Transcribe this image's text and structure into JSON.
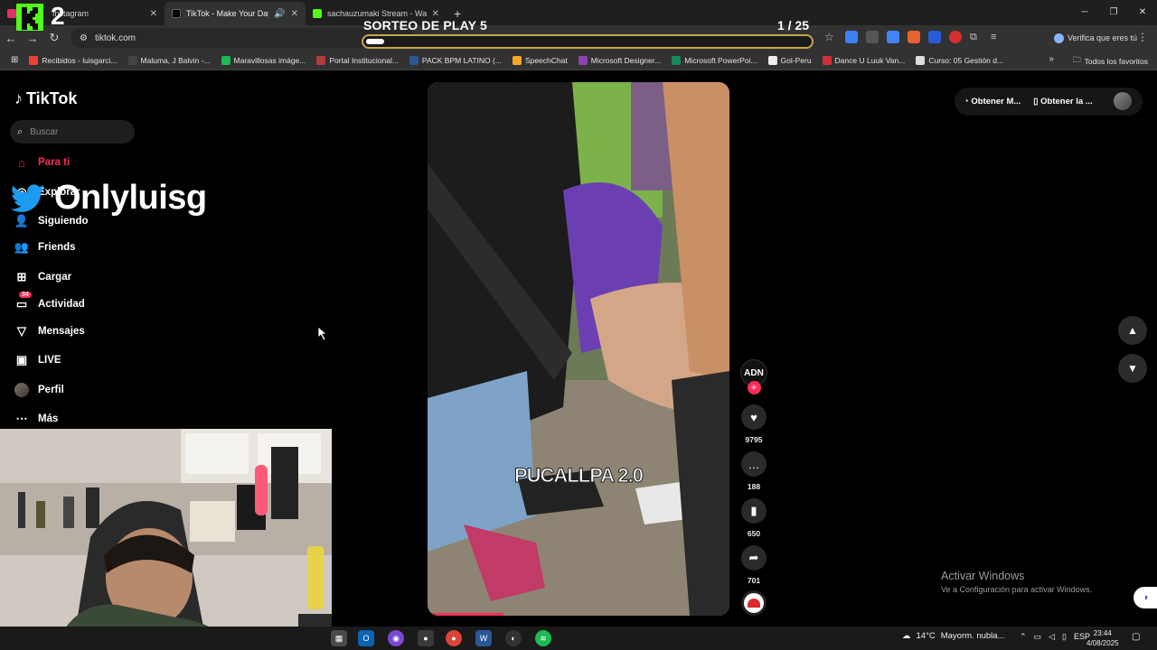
{
  "browser": {
    "tabs": [
      {
        "title": "Instagram",
        "favicon_color": "#e1306c"
      },
      {
        "title": "TikTok - Make Your Day",
        "favicon_color": "#000000",
        "active": true
      },
      {
        "title": "sachauzumaki Stream - Watch",
        "favicon_color": "#53fc18"
      }
    ],
    "new_tab": "+",
    "url": "tiktok.com",
    "verify_label": "Verifica que eres tú",
    "bookmarks": [
      {
        "label": "Recibidos - luisgarci...",
        "color": "#ea4335"
      },
      {
        "label": "Maluma, J Balvin -...",
        "color": "#444444"
      },
      {
        "label": "Maravillosas imáge...",
        "color": "#1db954"
      },
      {
        "label": "Portal Institucional...",
        "color": "#b23b3b"
      },
      {
        "label": "PACK BPM LATINO (...",
        "color": "#2b5797"
      },
      {
        "label": "SpeechChat",
        "color": "#f5a623"
      },
      {
        "label": "Microsoft Designer...",
        "color": "#8e44ad"
      },
      {
        "label": "Microsoft PowerPoi...",
        "color": "#1a8a5a"
      },
      {
        "label": "Gol-Peru",
        "color": "#eeeeee"
      },
      {
        "label": "Dance U Luuk Van...",
        "color": "#d0303a"
      },
      {
        "label": "Curso: 05 Gestión d...",
        "color": "#dddddd"
      }
    ],
    "all_favorites": "Todos los favoritos"
  },
  "stream_overlay": {
    "logo_number": "2",
    "giveaway_title": "SORTEO DE PLAY 5",
    "giveaway_count": "1  / 25",
    "giveaway_progress": 0.04,
    "twitter_handle": "Onlyluisg"
  },
  "tiktok": {
    "logo": "TikTok",
    "search_placeholder": "Buscar",
    "nav": [
      {
        "label": "Para ti",
        "icon": "home-icon",
        "active": true
      },
      {
        "label": "Explorar",
        "icon": "compass-icon"
      },
      {
        "label": "Siguiendo",
        "icon": "following-icon"
      },
      {
        "label": "Friends",
        "icon": "friends-icon"
      },
      {
        "label": "Cargar",
        "icon": "upload-icon"
      },
      {
        "label": "Actividad",
        "icon": "inbox-icon",
        "badge": "34"
      },
      {
        "label": "Mensajes",
        "icon": "send-icon"
      },
      {
        "label": "LIVE",
        "icon": "live-icon"
      },
      {
        "label": "Perfil",
        "icon": "avatar-icon"
      },
      {
        "label": "Más",
        "icon": "more-icon"
      }
    ],
    "top_buttons": [
      "Obtener M...",
      "Obtener la ..."
    ],
    "video": {
      "caption": "PUCALLPA 2.0",
      "progress": 0.25,
      "creator": "ADN"
    },
    "actions": {
      "likes": "9795",
      "comments": "188",
      "saves": "650",
      "shares": "701"
    }
  },
  "windows": {
    "activate_title": "Activar Windows",
    "activate_sub": "Ve a Configuración para activar Windows.",
    "weather_temp": "14°C",
    "weather_text": "Mayorm. nubla...",
    "lang": "ESP",
    "time": "23:44",
    "date": "4/08/2025"
  }
}
